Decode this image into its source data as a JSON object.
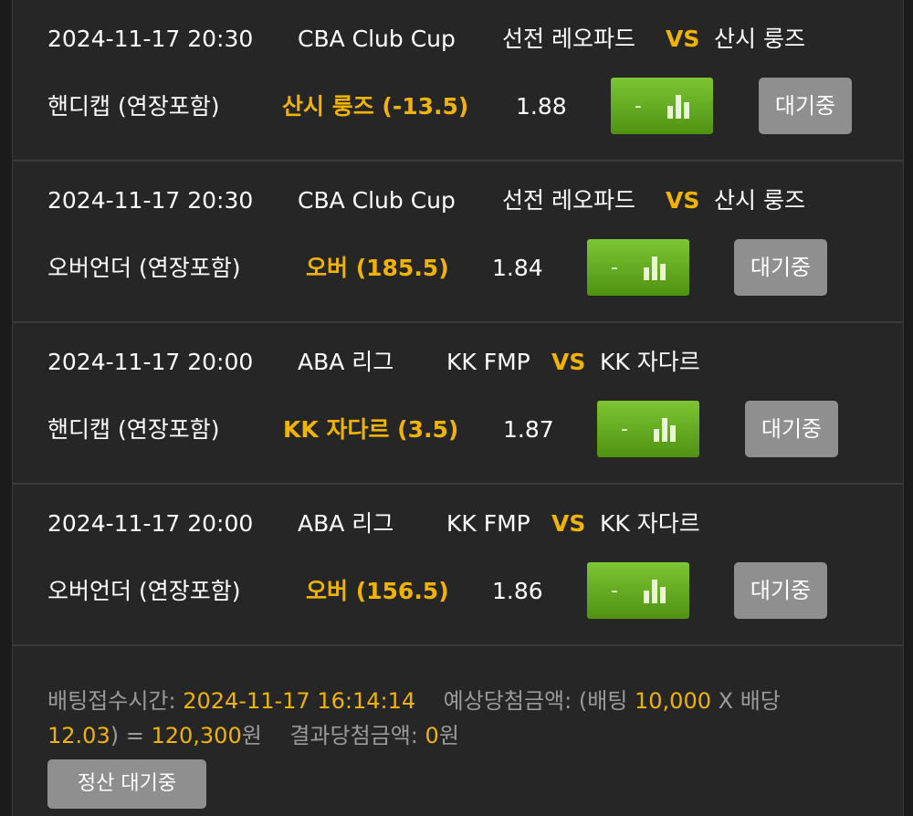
{
  "bets": [
    {
      "datetime": "2024-11-17 20:30",
      "league": "CBA Club Cup",
      "home": "선전 레오파드",
      "vs": "VS",
      "away": "산시 룽즈",
      "market": "핸디캡 (연장포함)",
      "selection": "산시 룽즈 (-13.5)",
      "odds": "1.88",
      "chart_dash": "-",
      "status": "대기중"
    },
    {
      "datetime": "2024-11-17 20:30",
      "league": "CBA Club Cup",
      "home": "선전 레오파드",
      "vs": "VS",
      "away": "산시 룽즈",
      "market": "오버언더 (연장포함)",
      "selection": "오버 (185.5)",
      "odds": "1.84",
      "chart_dash": "-",
      "status": "대기중"
    },
    {
      "datetime": "2024-11-17 20:00",
      "league": "ABA 리그",
      "home": "KK FMP",
      "vs": "VS",
      "away": "KK 자다르",
      "market": "핸디캡 (연장포함)",
      "selection": "KK 자다르 (3.5)",
      "odds": "1.87",
      "chart_dash": "-",
      "status": "대기중"
    },
    {
      "datetime": "2024-11-17 20:00",
      "league": "ABA 리그",
      "home": "KK FMP",
      "vs": "VS",
      "away": "KK 자다르",
      "market": "오버언더 (연장포함)",
      "selection": "오버 (156.5)",
      "odds": "1.86",
      "chart_dash": "-",
      "status": "대기중"
    }
  ],
  "summary": {
    "accept_label": "배팅접수시간:",
    "accept_time": "2024-11-17 16:14:14",
    "expected_label": "예상당첨금액: (배팅",
    "stake": "10,000",
    "times_label": "X 배당",
    "total_odds": "12.03",
    "equals_open": ") =",
    "expected_win": "120,300",
    "won_unit": "원",
    "result_label": "결과당첨금액:",
    "result_amount": "0",
    "result_unit": "원"
  },
  "settle_button": "정산 대기중",
  "colors": {
    "accent": "#f0b400",
    "chart_button": "#5ea61f",
    "status_button": "#8f8f8f",
    "panel": "#262626"
  },
  "icons": {
    "chart": "bar-chart-icon"
  }
}
